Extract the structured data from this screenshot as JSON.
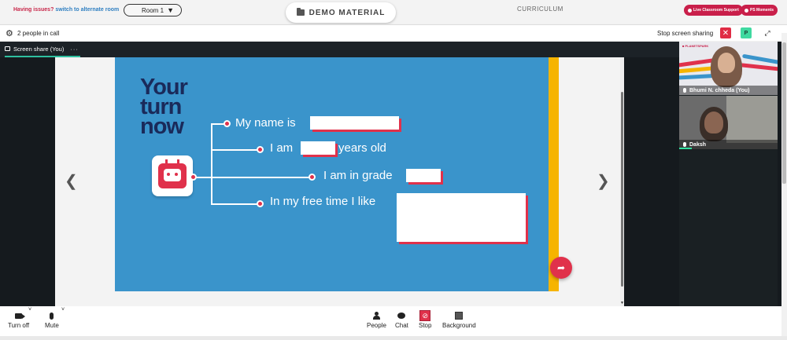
{
  "topbar": {
    "issue_text": "Having issues?",
    "alt_link": "switch to alternate room",
    "room": "Room 1",
    "demo_material": "DEMO MATERIAL",
    "curriculum": "CURRICULUM",
    "live_support": "Live Classroom Support",
    "ps_moments": "PS Moments"
  },
  "callhead": {
    "people_count": "2 people in call",
    "stop_sharing": "Stop screen sharing",
    "p_badge": "P"
  },
  "tab": {
    "label": "Screen share (You)"
  },
  "slide": {
    "title_lines": [
      "Your",
      "turn",
      "now"
    ],
    "prompts": [
      "My name is",
      "I am",
      "years old",
      "I am in grade",
      "In my free time I like"
    ]
  },
  "participants": [
    {
      "name": "Bhumi N. chheda (You)"
    },
    {
      "name": "Daksh"
    }
  ],
  "toolbar": {
    "turn_off": "Turn off",
    "mute": "Mute",
    "people": "People",
    "chat": "Chat",
    "stop": "Stop",
    "background": "Background"
  },
  "colors": {
    "accent_red": "#c91f4a",
    "slide_blue": "#3a94cb",
    "teal": "#2fbf9f"
  },
  "icons": [
    "folder-icon",
    "gear-icon",
    "close-icon",
    "expand-icon",
    "share-icon",
    "camera-icon",
    "mic-icon",
    "people-icon",
    "chat-icon",
    "stop-icon",
    "background-icon"
  ]
}
